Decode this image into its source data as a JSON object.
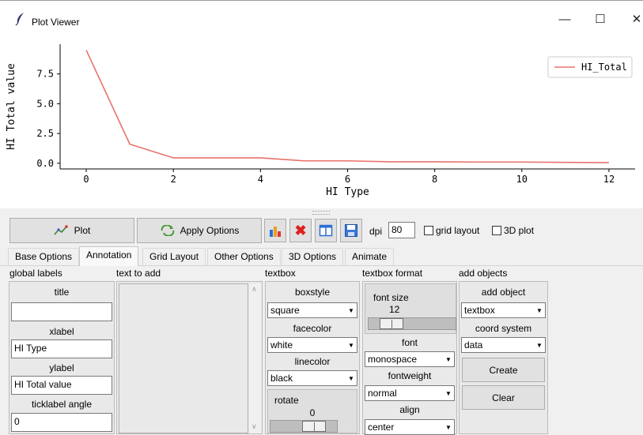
{
  "window": {
    "title": "Plot Viewer",
    "controls": {
      "minimize": "—",
      "maximize": "☐",
      "close": "✕"
    }
  },
  "chart_data": {
    "type": "line",
    "x": [
      0,
      1,
      2,
      3,
      4,
      5,
      6,
      7,
      8,
      9,
      10,
      11,
      12
    ],
    "series": [
      {
        "name": "HI_Total",
        "color": "#e8716d",
        "values": [
          9.5,
          1.6,
          0.45,
          0.45,
          0.45,
          0.2,
          0.2,
          0.12,
          0.12,
          0.1,
          0.1,
          0.07,
          0.05
        ]
      }
    ],
    "xlabel": "HI Type",
    "ylabel": "HI Total value",
    "xticks": [
      "0",
      "2",
      "4",
      "6",
      "8",
      "10",
      "12"
    ],
    "yticks": [
      "0.0",
      "2.5",
      "5.0",
      "7.5"
    ],
    "xlim": [
      -0.6,
      12.6
    ],
    "ylim": [
      -0.48,
      10.0
    ],
    "legend_position": "upper right",
    "grid": false
  },
  "toolbar": {
    "plot_label": "Plot",
    "apply_label": "Apply Options",
    "dpi_label": "dpi",
    "dpi_value": "80",
    "grid_layout_label": "grid layout",
    "plot3d_label": "3D plot"
  },
  "tabs": [
    "Base Options",
    "Annotation",
    "Grid Layout",
    "Other Options",
    "3D Options",
    "Animate"
  ],
  "annotation": {
    "sections": {
      "global_labels": "global labels",
      "text_to_add": "text to add",
      "textbox": "textbox",
      "textbox_format": "textbox format",
      "add_objects": "add objects"
    },
    "global_labels": {
      "title_label": "title",
      "title_value": "",
      "xlabel_label": "xlabel",
      "xlabel_value": "HI Type",
      "ylabel_label": "ylabel",
      "ylabel_value": "HI Total value",
      "ticklabel_angle_label": "ticklabel angle",
      "ticklabel_angle_value": "0"
    },
    "textbox": {
      "boxstyle_label": "boxstyle",
      "boxstyle_value": "square",
      "facecolor_label": "facecolor",
      "facecolor_value": "white",
      "linecolor_label": "linecolor",
      "linecolor_value": "black",
      "rotate_label": "rotate",
      "rotate_value": "0"
    },
    "textbox_format": {
      "fontsize_label": "font size",
      "fontsize_value": "12",
      "font_label": "font",
      "font_value": "monospace",
      "fontweight_label": "fontweight",
      "fontweight_value": "normal",
      "align_label": "align",
      "align_value": "center"
    },
    "add_objects": {
      "add_object_label": "add object",
      "add_object_value": "textbox",
      "coord_system_label": "coord system",
      "coord_system_value": "data",
      "create_label": "Create",
      "clear_label": "Clear"
    }
  }
}
